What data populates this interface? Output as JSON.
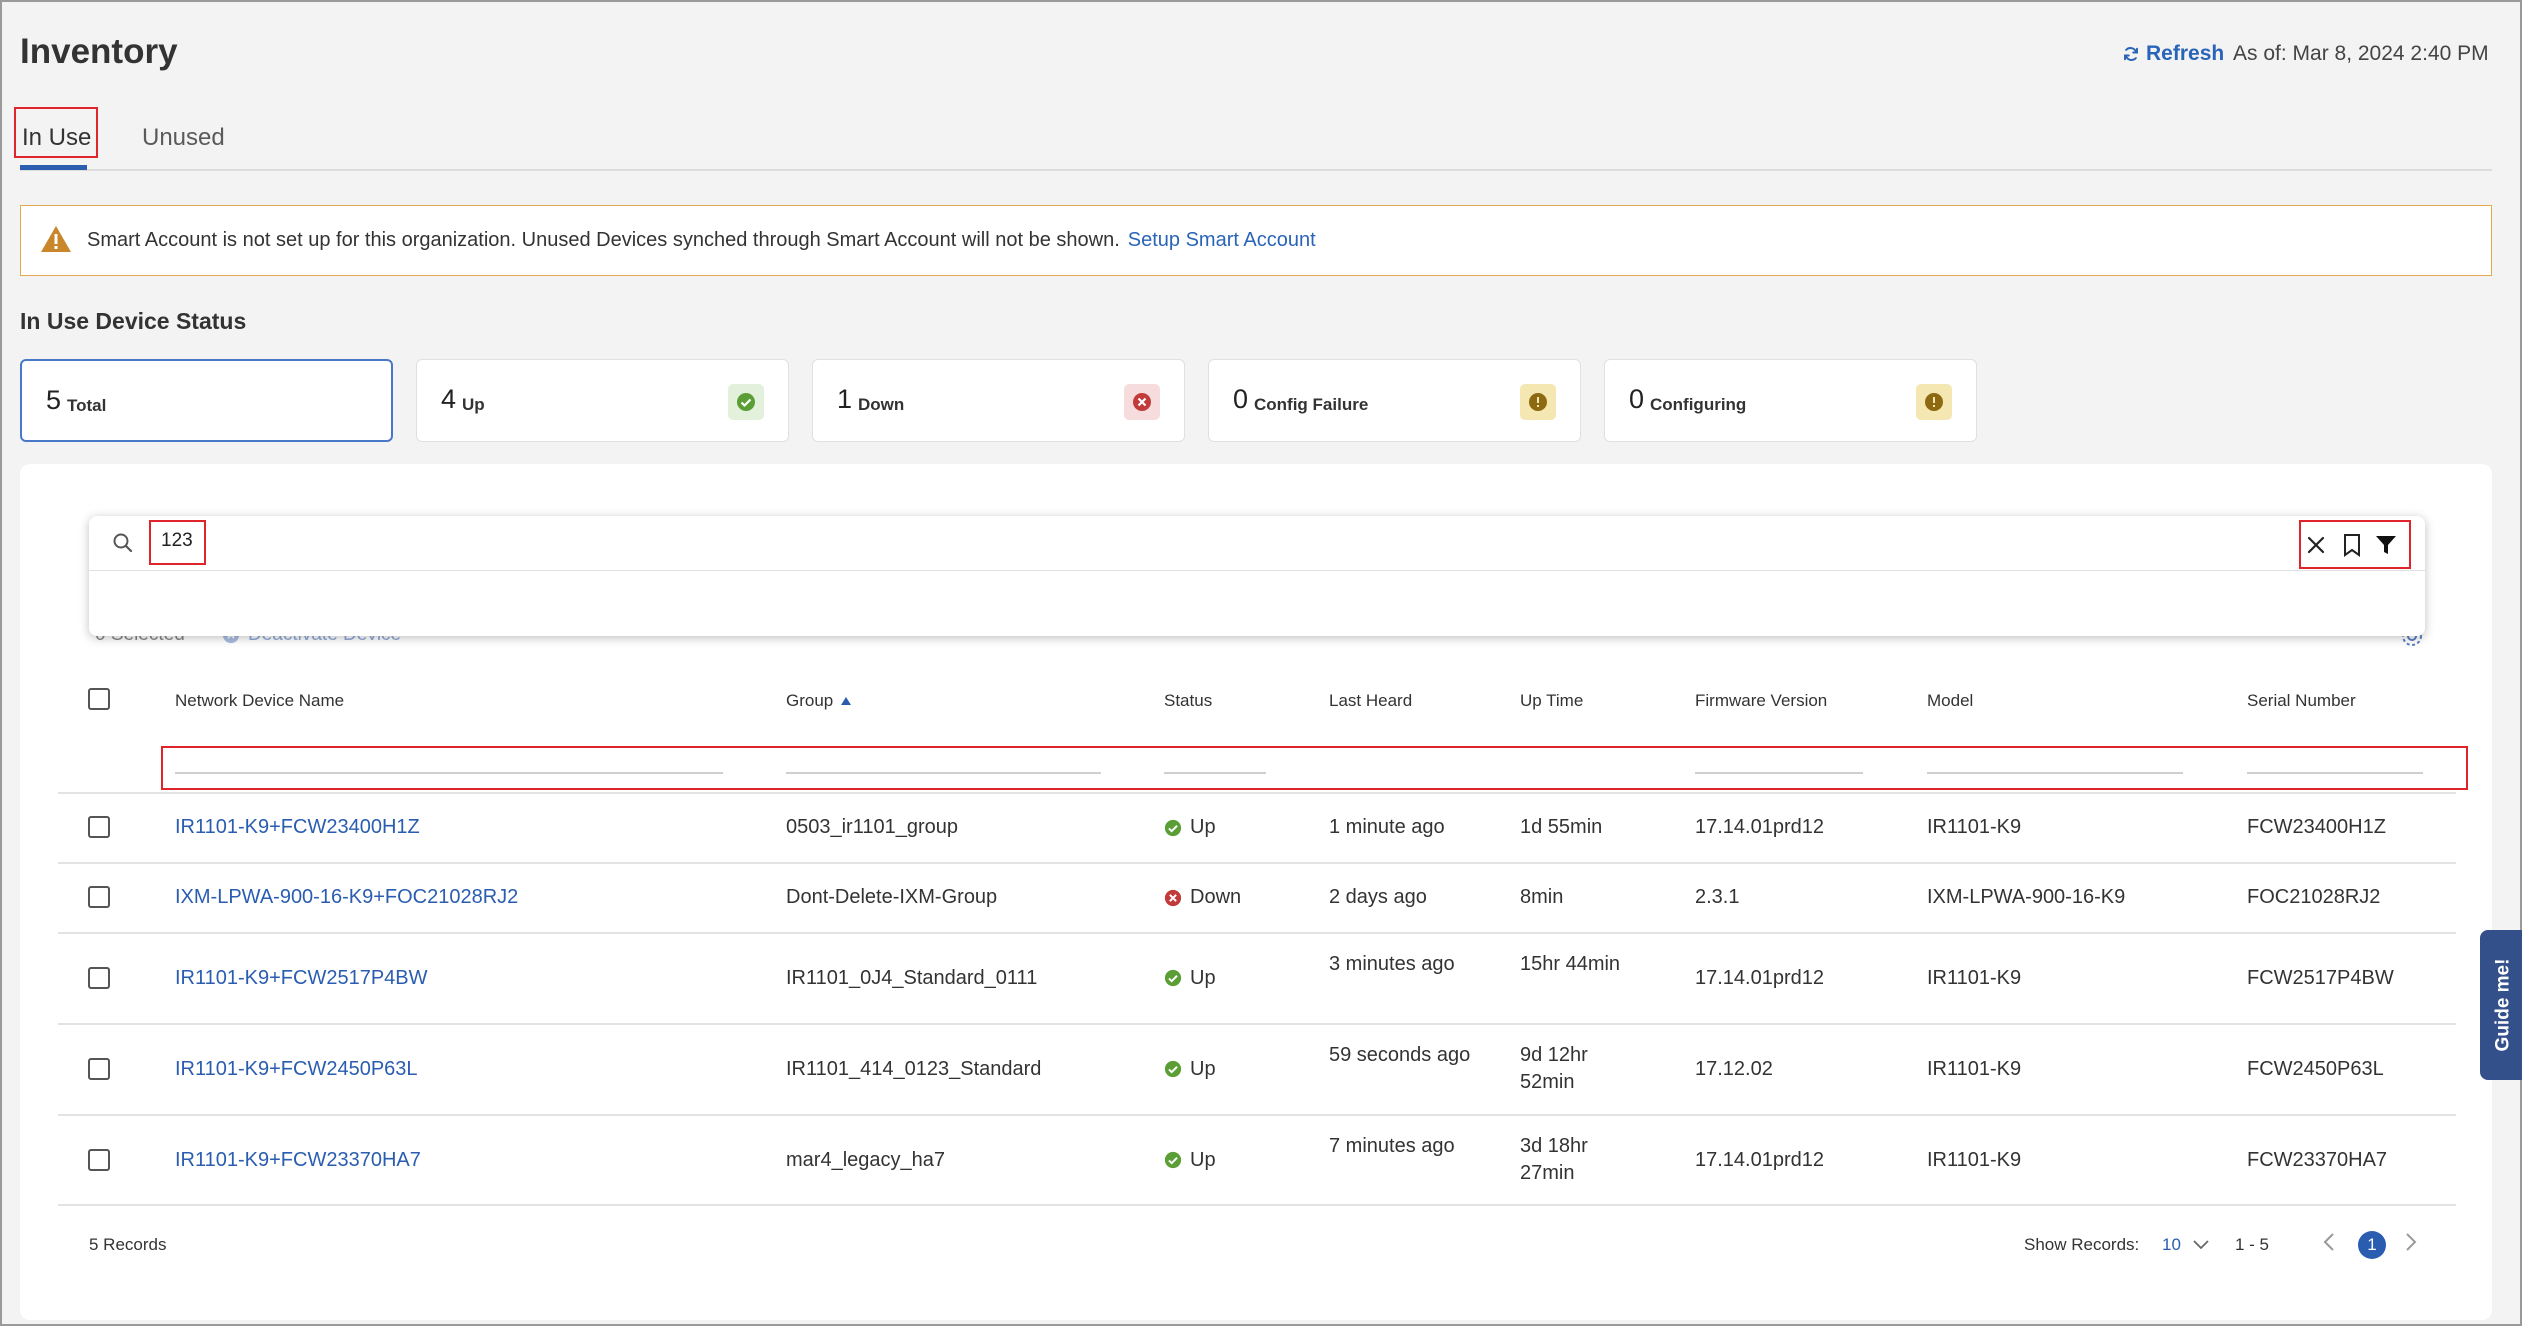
{
  "page": {
    "title": "Inventory",
    "refresh_label": "Refresh",
    "as_of": "As of: Mar 8, 2024 2:40 PM"
  },
  "tabs": [
    {
      "label": "In Use",
      "active": true
    },
    {
      "label": "Unused",
      "active": false
    }
  ],
  "banner": {
    "message": "Smart Account is not set up for this organization. Unused Devices synched through Smart Account will not be shown.",
    "link": "Setup Smart Account"
  },
  "status": {
    "title": "In Use Device Status",
    "cards": [
      {
        "count": "5",
        "label": "Total"
      },
      {
        "count": "4",
        "label": "Up"
      },
      {
        "count": "1",
        "label": "Down"
      },
      {
        "count": "0",
        "label": "Config Failure"
      },
      {
        "count": "0",
        "label": "Configuring"
      }
    ]
  },
  "search": {
    "value": "123"
  },
  "toolbar": {
    "selected": "0 Selected",
    "deactivate": "Deactivate Device"
  },
  "table": {
    "columns": [
      "Network Device Name",
      "Group",
      "Status",
      "Last Heard",
      "Up Time",
      "Firmware Version",
      "Model",
      "Serial Number"
    ],
    "rows": [
      {
        "name": "IR1101-K9+FCW23400H1Z",
        "group": "0503_ir1101_group",
        "status": "Up",
        "last_heard": "1 minute ago",
        "uptime": "1d 55min",
        "firmware": "17.14.01prd12",
        "model": "IR1101-K9",
        "serial": "FCW23400H1Z"
      },
      {
        "name": "IXM-LPWA-900-16-K9+FOC21028RJ2",
        "group": "Dont-Delete-IXM-Group",
        "status": "Down",
        "last_heard": "2 days ago",
        "uptime": "8min",
        "firmware": "2.3.1",
        "model": "IXM-LPWA-900-16-K9",
        "serial": "FOC21028RJ2"
      },
      {
        "name": "IR1101-K9+FCW2517P4BW",
        "group": "IR1101_0J4_Standard_0111",
        "status": "Up",
        "last_heard": "3 minutes ago",
        "uptime": "15hr 44min",
        "firmware": "17.14.01prd12",
        "model": "IR1101-K9",
        "serial": "FCW2517P4BW"
      },
      {
        "name": "IR1101-K9+FCW2450P63L",
        "group": "IR1101_414_0123_Standard",
        "status": "Up",
        "last_heard": "59 seconds ago",
        "uptime": "9d 12hr 52min",
        "firmware": "17.12.02",
        "model": "IR1101-K9",
        "serial": "FCW2450P63L"
      },
      {
        "name": "IR1101-K9+FCW23370HA7",
        "group": "mar4_legacy_ha7",
        "status": "Up",
        "last_heard": "7 minutes ago",
        "uptime": "3d 18hr 27min",
        "firmware": "17.14.01prd12",
        "model": "IR1101-K9",
        "serial": "FCW23370HA7"
      }
    ]
  },
  "footer": {
    "records": "5 Records",
    "show_records_label": "Show Records:",
    "show_records_value": "10",
    "range": "1 - 5",
    "page": "1"
  },
  "guide": {
    "label": "Guide me!"
  },
  "colors": {
    "accent": "#2a5db0",
    "up": "#5a9e35",
    "down": "#c23b3b",
    "warning": "#c99a14",
    "highlight": "#e0242c"
  }
}
